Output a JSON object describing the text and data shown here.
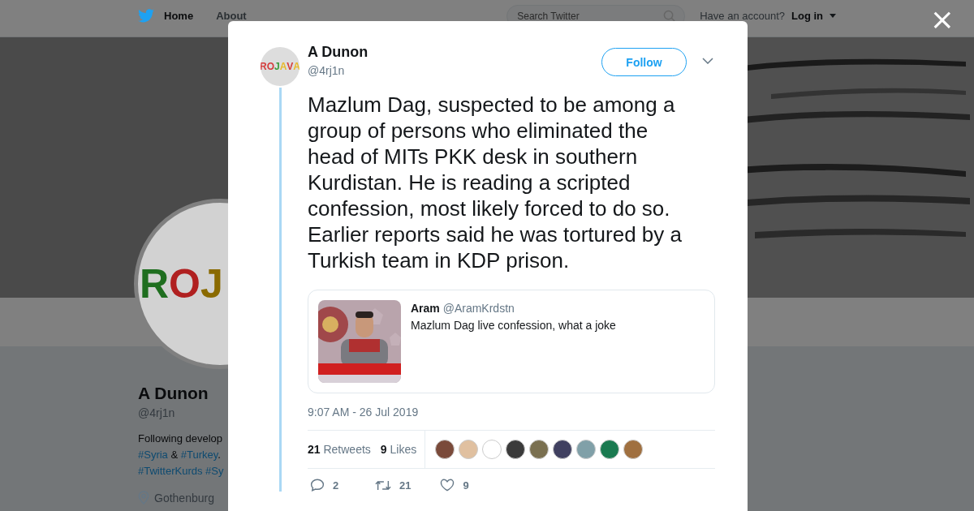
{
  "top_nav": {
    "links": [
      {
        "label": "Home",
        "selected": true
      },
      {
        "label": "About",
        "selected": false
      }
    ],
    "search": {
      "placeholder": "Search Twitter"
    },
    "account_prompt": "Have an account?",
    "login": "Log in"
  },
  "profile": {
    "avatar_letters": [
      {
        "text": "R",
        "color": "#1f6e1f"
      },
      {
        "text": "O",
        "color": "#b02020"
      },
      {
        "text": "J",
        "color": "#8a6a00"
      }
    ],
    "name": "A Dunon",
    "handle": "@4rj1n",
    "bio": [
      "Following develop",
      "**#Syria** & **#Turkey**.",
      "**#TwitterKurds** **#Sy**"
    ],
    "location": "Gothenburg"
  },
  "modal": {
    "close": "×",
    "tweet": {
      "avatar_letters": [
        {
          "text": "R",
          "color": "#d43b3b"
        },
        {
          "text": "O",
          "color": "#d43b3b"
        },
        {
          "text": "J",
          "color": "#3a9a3a"
        },
        {
          "text": "A",
          "color": "#e8b92a"
        },
        {
          "text": "V",
          "color": "#d43b3b"
        },
        {
          "text": "A",
          "color": "#e8b92a"
        }
      ],
      "name": "A Dunon",
      "handle": "@4rj1n",
      "follow": "Follow",
      "text": "Mazlum Dag, suspected to be among a group of persons who eliminated the head of MITs PKK desk in southern Kurdistan. He is reading a scripted confession, most likely forced to do so. Earlier reports said he was tortured by a Turkish team in KDP prison.",
      "quote": {
        "name": "Aram",
        "handle": "@AramKrdstn",
        "text": "Mazlum Dag live confession, what a joke"
      },
      "timestamp": "9:07 AM - 26 Jul 2019",
      "stats": [
        {
          "count": "21",
          "label": "Retweets"
        },
        {
          "count": "9",
          "label": "Likes"
        }
      ],
      "likers": [
        {
          "color": "#7a4a3a"
        },
        {
          "color": "#e0c0a0"
        },
        {
          "color": "#ffffff"
        },
        {
          "color": "#3a3a3a"
        },
        {
          "color": "#7a7050"
        },
        {
          "color": "#404060"
        },
        {
          "color": "#80a0a8"
        },
        {
          "color": "#1a7a50"
        },
        {
          "color": "#a07040"
        }
      ],
      "actions": [
        {
          "kind": "reply",
          "count": "2"
        },
        {
          "kind": "retweet",
          "count": "21"
        },
        {
          "kind": "like",
          "count": "9"
        }
      ]
    }
  }
}
